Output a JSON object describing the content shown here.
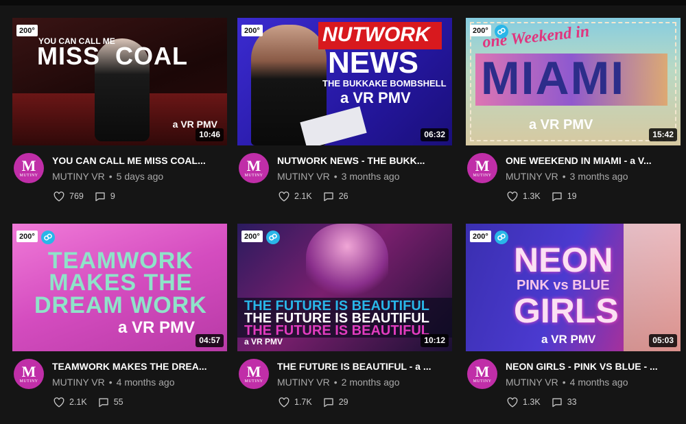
{
  "videos": [
    {
      "badge": "200°",
      "has_sync": false,
      "duration": "10:46",
      "title": "YOU CAN CALL ME MISS COAL...",
      "channel": "MUTINY VR",
      "age": "5 days ago",
      "likes": "769",
      "comments": "9",
      "thumb_small": "YOU CAN CALL ME",
      "thumb_big": "MISS  COAL",
      "thumb_sub": "a VR PMV",
      "bg": "#2a0c0c"
    },
    {
      "badge": "200°",
      "has_sync": false,
      "duration": "06:32",
      "title": "NUTWORK NEWS - THE BUKK...",
      "channel": "MUTINY VR",
      "age": "3 months ago",
      "likes": "2.1K",
      "comments": "26",
      "thumb_small": "NUTWORK",
      "thumb_big": "NEWS",
      "thumb_line": "THE BUKKAKE BOMBSHELL",
      "thumb_sub": "a VR PMV",
      "bg": "#2f1fb6"
    },
    {
      "badge": "200°",
      "has_sync": true,
      "duration": "15:42",
      "title": "ONE WEEKEND IN MIAMI - a V...",
      "channel": "MUTINY VR",
      "age": "3 months ago",
      "likes": "1.3K",
      "comments": "19",
      "thumb_small": "one Weekend in",
      "thumb_big": "MIAMI",
      "thumb_sub": "a VR PMV",
      "bg": "#d9c9a8"
    },
    {
      "badge": "200°",
      "has_sync": true,
      "duration": "04:57",
      "title": "TEAMWORK MAKES THE DREA...",
      "channel": "MUTINY VR",
      "age": "4 months ago",
      "likes": "2.1K",
      "comments": "55",
      "thumb_big": "TEAMWORK\nMAKES THE\nDREAM WORK",
      "thumb_sub": "a VR PMV",
      "bg": "#e05ac8"
    },
    {
      "badge": "200°",
      "has_sync": true,
      "duration": "10:12",
      "title": "THE FUTURE IS BEAUTIFUL - a ...",
      "channel": "MUTINY VR",
      "age": "2 months ago",
      "likes": "1.7K",
      "comments": "29",
      "thumb_big": "THE FUTURE IS BEAUTIFUL",
      "thumb_sub": "a VR PMV",
      "bg": "#1a1033"
    },
    {
      "badge": "200°",
      "has_sync": true,
      "duration": "05:03",
      "title": "NEON GIRLS - PINK VS BLUE - ...",
      "channel": "MUTINY VR",
      "age": "4 months ago",
      "likes": "1.3K",
      "comments": "33",
      "thumb_big": "NEON",
      "thumb_line": "PINK vs BLUE",
      "thumb_big2": "GIRLS",
      "thumb_sub": "a VR PMV",
      "bg": "#3a2fb0"
    }
  ],
  "avatar": {
    "letter": "M",
    "word": "MUTINY"
  },
  "colors": {
    "background": "#151515",
    "avatar": "#c02ea8",
    "sync_badge": "#29b6e8",
    "meta_text": "#a9a9a9"
  }
}
